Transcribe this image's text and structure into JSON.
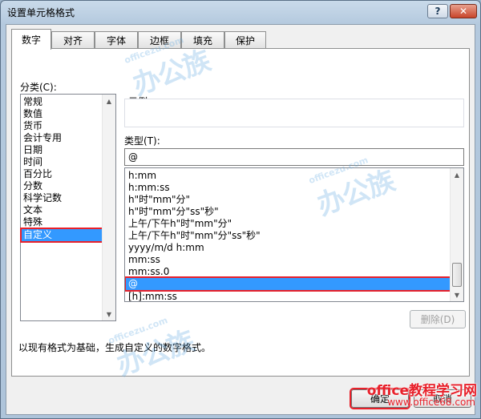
{
  "window": {
    "title": "设置单元格格式",
    "help_label": "?",
    "close_label": "✕"
  },
  "tabs": [
    {
      "label": "数字",
      "active": true
    },
    {
      "label": "对齐",
      "active": false
    },
    {
      "label": "字体",
      "active": false
    },
    {
      "label": "边框",
      "active": false
    },
    {
      "label": "填充",
      "active": false
    },
    {
      "label": "保护",
      "active": false
    }
  ],
  "category": {
    "label": "分类(C):",
    "items": [
      "常规",
      "数值",
      "货币",
      "会计专用",
      "日期",
      "时间",
      "百分比",
      "分数",
      "科学记数",
      "文本",
      "特殊",
      "自定义"
    ],
    "selected": "自定义"
  },
  "sample": {
    "label": "示例"
  },
  "type": {
    "label": "类型(T):",
    "value": "@",
    "items": [
      "h:mm",
      "h:mm:ss",
      "h\"时\"mm\"分\"",
      "h\"时\"mm\"分\"ss\"秒\"",
      "上午/下午h\"时\"mm\"分\"",
      "上午/下午h\"时\"mm\"分\"ss\"秒\"",
      "yyyy/m/d h:mm",
      "mm:ss",
      "mm:ss.0",
      "@",
      "[h]:mm:ss"
    ],
    "selected": "@"
  },
  "delete_button": "删除(D)",
  "description": "以现有格式为基础，生成自定义的数字格式。",
  "footer": {
    "ok": "确定",
    "cancel": "取消"
  },
  "watermark": {
    "text": "办公族",
    "url": "officezu.com"
  },
  "site_banner": {
    "line1": "office教程学习网",
    "line2": "www.office68.com"
  }
}
